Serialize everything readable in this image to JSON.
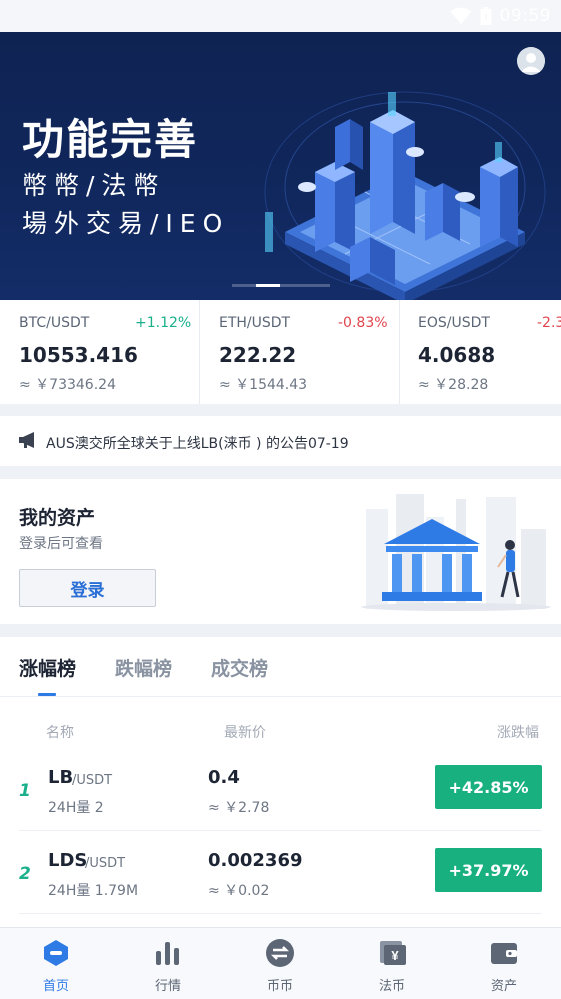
{
  "status_bar": {
    "time": "09:59"
  },
  "banner": {
    "title": "功能完善",
    "line1": "幣幣/法幣",
    "line2": "場外交易/IEO"
  },
  "tickers": [
    {
      "pair": "BTC/USDT",
      "change": "+1.12%",
      "price": "10553.416",
      "cny": "≈ ￥73346.24",
      "direction": "up"
    },
    {
      "pair": "ETH/USDT",
      "change": "-0.83%",
      "price": "222.22",
      "cny": "≈ ￥1544.43",
      "direction": "down"
    },
    {
      "pair": "EOS/USDT",
      "change": "-2.3",
      "price": "4.0688",
      "cny": "≈ ￥28.28",
      "direction": "down"
    }
  ],
  "notice": {
    "text": "AUS澳交所全球关于上线LB(涞币 ) 的公告07-19"
  },
  "asset": {
    "title": "我的资产",
    "subtitle": "登录后可查看",
    "login_label": "登录"
  },
  "ranking": {
    "tabs": [
      "涨幅榜",
      "跌幅榜",
      "成交榜"
    ],
    "active_tab": 0,
    "columns": {
      "name": "名称",
      "price": "最新价",
      "change": "涨跌幅"
    },
    "rows": [
      {
        "rank": "1",
        "symbol": "LB",
        "quote": "/USDT",
        "volume": "24H量 2",
        "price": "0.4",
        "cny": "≈ ￥2.78",
        "change": "+42.85%"
      },
      {
        "rank": "2",
        "symbol": "LDS",
        "quote": "/USDT",
        "volume": "24H量 1.79M",
        "price": "0.002369",
        "cny": "≈ ￥0.02",
        "change": "+37.97%"
      }
    ]
  },
  "bottom_nav": [
    {
      "label": "首页",
      "icon": "home-icon",
      "active": true
    },
    {
      "label": "行情",
      "icon": "market-bars-icon",
      "active": false
    },
    {
      "label": "币币",
      "icon": "exchange-icon",
      "active": false
    },
    {
      "label": "法币",
      "icon": "fiat-icon",
      "active": false
    },
    {
      "label": "资产",
      "icon": "wallet-icon",
      "active": false
    }
  ],
  "colors": {
    "up": "#19b08b",
    "down": "#e0454f",
    "accent": "#2f7be6",
    "banner_bg": "#10275c",
    "badge_green": "#19b080"
  }
}
